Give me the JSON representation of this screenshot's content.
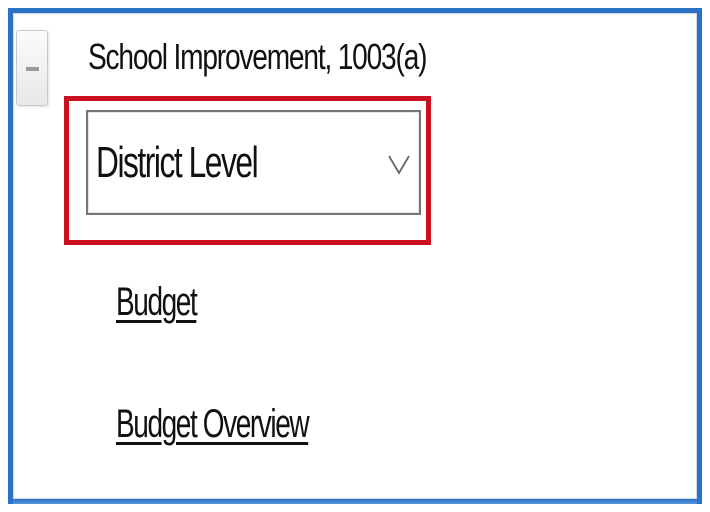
{
  "panel": {
    "section_title": "School Improvement, 1003(a)",
    "collapse_icon": "minus-icon",
    "accent_border_color": "#2a72c8",
    "highlight_color": "#c8101e"
  },
  "level_select": {
    "selected": "District Level",
    "icon": "chevron-down-icon"
  },
  "links": {
    "budget": "Budget",
    "budget_overview": "Budget Overview"
  }
}
